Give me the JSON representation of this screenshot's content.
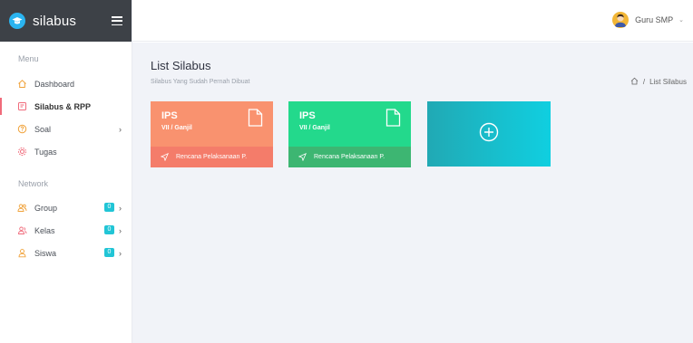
{
  "brand": {
    "name": "silabus"
  },
  "sidebar": {
    "menu_title": "Menu",
    "menu_items": [
      {
        "label": "Dashboard",
        "icon": "home-icon"
      },
      {
        "label": "Silabus & RPP",
        "icon": "document-icon",
        "active": true
      },
      {
        "label": "Soal",
        "icon": "question-icon"
      },
      {
        "label": "Tugas",
        "icon": "gear-icon"
      }
    ],
    "network_title": "Network",
    "network_items": [
      {
        "label": "Group",
        "badge": "0",
        "icon": "group-icon"
      },
      {
        "label": "Kelas",
        "badge": "0",
        "icon": "users-icon"
      },
      {
        "label": "Siswa",
        "badge": "0",
        "icon": "user-icon"
      }
    ]
  },
  "header": {
    "user_name": "Guru SMP"
  },
  "main": {
    "title": "List Silabus",
    "subtitle": "Silabus Yang Sudah Pernah Dibuat",
    "breadcrumb": "List Silabus",
    "cards": [
      {
        "subject": "IPS",
        "class": "VII / Ganjil",
        "footer": "Rencana Pelaksanaan P.",
        "color_top": "#f9926f",
        "color_bottom": "#f47c6a"
      },
      {
        "subject": "IPS",
        "class": "VII / Ganjil",
        "footer": "Rencana Pelaksanaan P.",
        "color_top": "#23d98c",
        "color_bottom": "#3db672"
      }
    ]
  },
  "colors": {
    "sidebar_brand_bg": "#3d4147",
    "accent_active": "#f06b7b",
    "badge": "#21c5d6",
    "main_bg": "#f1f3f8"
  }
}
